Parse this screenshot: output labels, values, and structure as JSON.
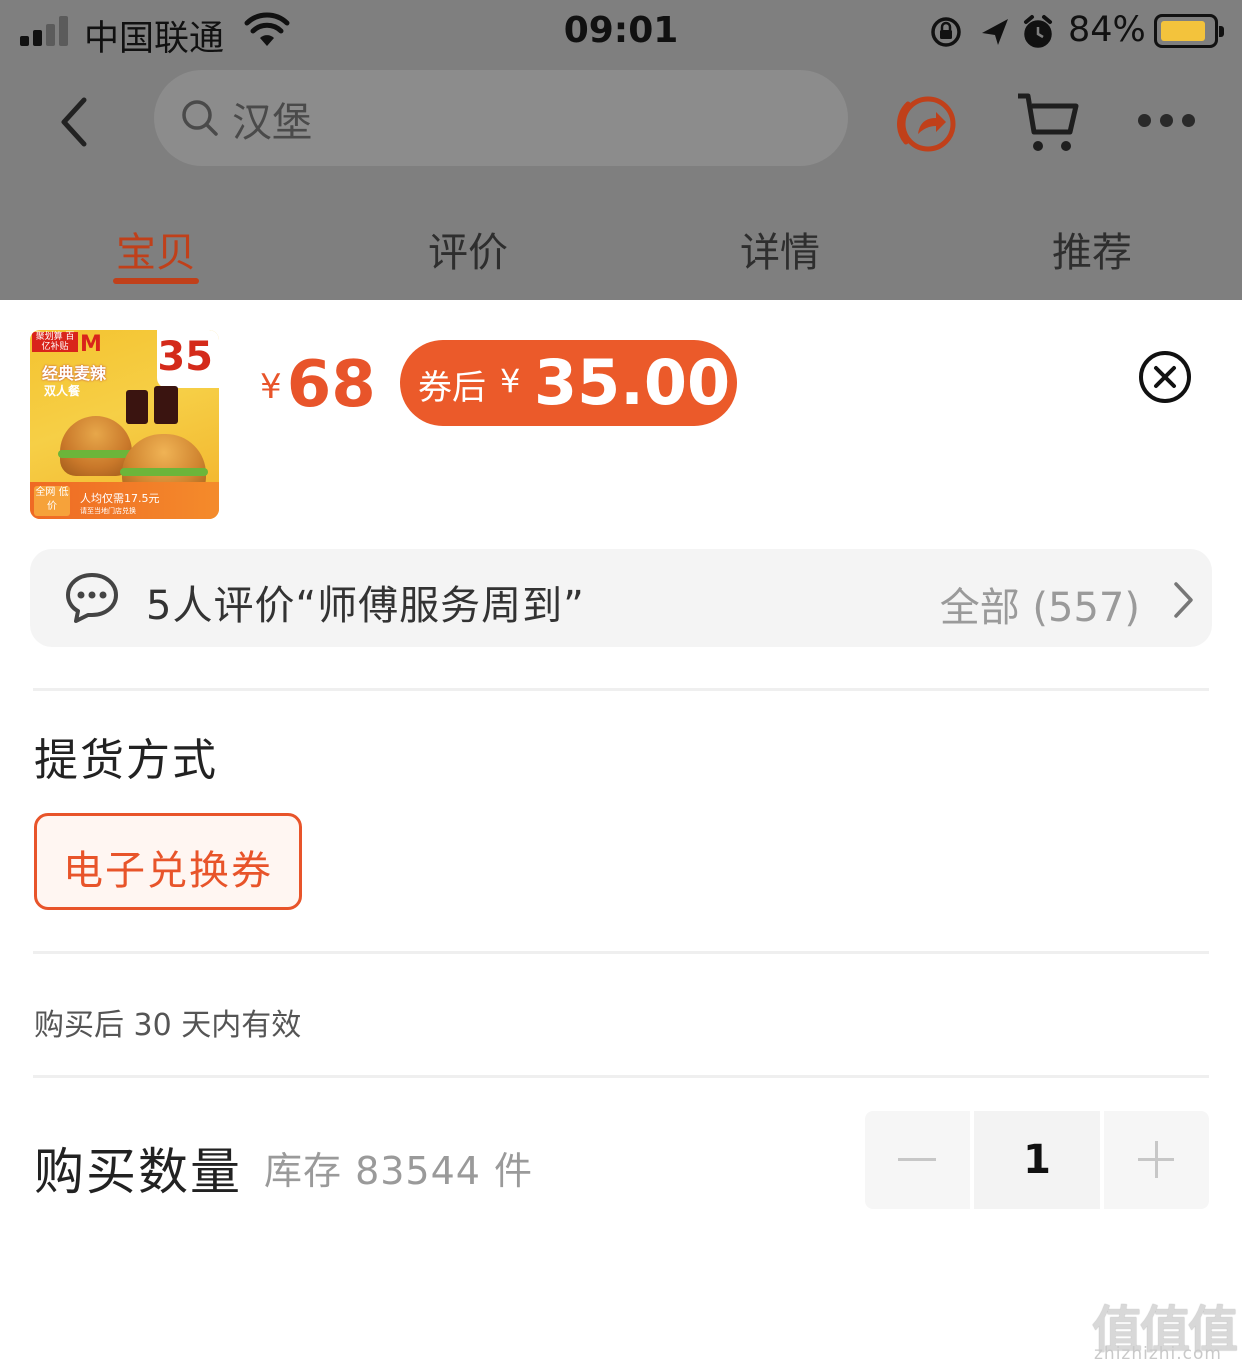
{
  "status_bar": {
    "carrier": "中国联通",
    "time": "09:01",
    "battery_percent": "84%",
    "battery_level": 0.84,
    "battery_color": "#f3c33c",
    "icons": [
      "signal-icon",
      "wifi-icon",
      "orientation-lock-icon",
      "location-icon",
      "alarm-icon",
      "battery-icon"
    ]
  },
  "nav": {
    "back_icon": "back-chevron-icon",
    "search_placeholder": "汉堡",
    "share_icon": "share-icon",
    "cart_icon": "cart-icon",
    "more_icon": "more-dots-icon"
  },
  "tabs": [
    {
      "label": "宝贝",
      "active": true
    },
    {
      "label": "评价",
      "active": false
    },
    {
      "label": "详情",
      "active": false
    },
    {
      "label": "推荐",
      "active": false
    }
  ],
  "product": {
    "thumbnail": {
      "corner_tag": "聚划算 百亿补贴",
      "price_badge": "35",
      "title": "经典麦辣",
      "subtitle": "双人餐",
      "side_tag": "全网 低价",
      "per_person": "人均仅需17.5元",
      "footnote": "请至当地门店兑换"
    },
    "price_currency": "¥",
    "price": "68",
    "coupon_label": "券后",
    "coupon_currency": "¥",
    "coupon_price": "35.00",
    "accent_color": "#e8542a"
  },
  "review_bar": {
    "text": "5人评价“师傅服务周到”",
    "all_label": "全部 (557)"
  },
  "pickup": {
    "title": "提货方式",
    "option": "电子兑换券"
  },
  "validity": "购买后 30 天内有效",
  "quantity": {
    "title": "购买数量",
    "stock": "库存 83544 件",
    "value": "1"
  },
  "watermark": {
    "glyphs": "值值值",
    "url": "zhizhizhi.com"
  }
}
